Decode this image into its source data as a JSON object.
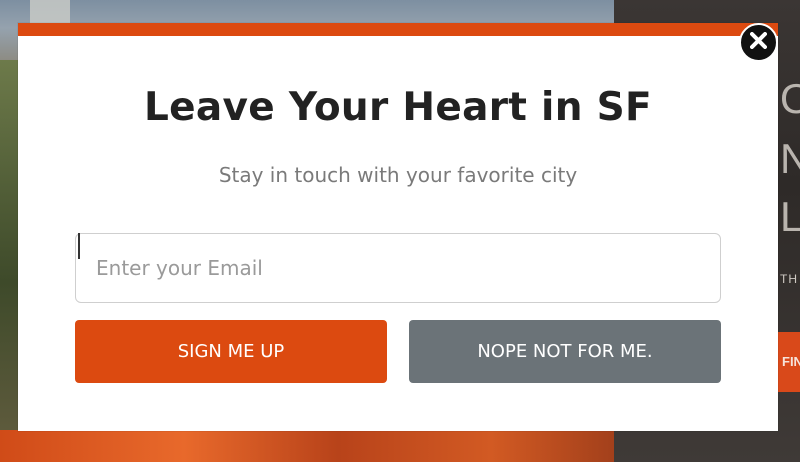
{
  "modal": {
    "title": "Leave Your Heart in SF",
    "subtitle": "Stay in touch with your favorite city",
    "email_placeholder": "Enter your Email",
    "signup_label": "SIGN ME UP",
    "decline_label": "NOPE NOT FOR ME.",
    "close_icon": "close-icon"
  },
  "background": {
    "right_letters": [
      "O",
      "N",
      "L"
    ],
    "right_small_text": "TH",
    "find_label": "FIN"
  },
  "colors": {
    "accent": "#dc4a10",
    "decline_button": "#6b7378",
    "title_text": "#222222",
    "subtitle_text": "#7a7a7a",
    "close_button": "#111111"
  }
}
